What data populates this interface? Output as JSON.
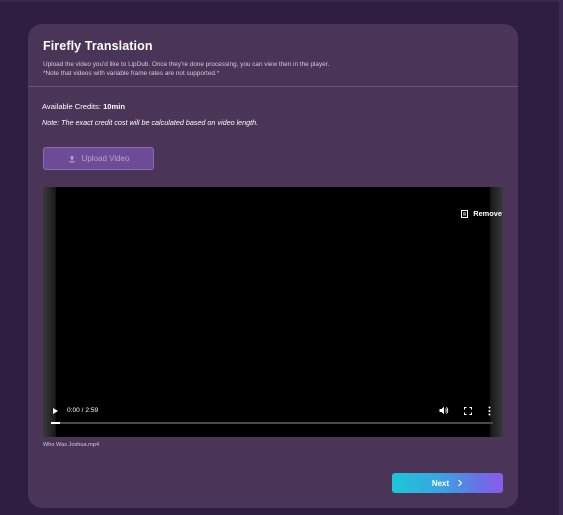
{
  "card": {
    "title": "Firefly Translation",
    "description_line1": "Upload the video you'd like to LipDub. Once they're done processing, you can view then in the player.",
    "description_line2": "*Note that videos with variable frame rates are not supported.*"
  },
  "credits": {
    "label": "Available Credits:",
    "value": "10min"
  },
  "note": "Note: The exact credit cost will be calculated based on video length.",
  "upload": {
    "label": "Upload Video",
    "icon": "upload-icon"
  },
  "video": {
    "remove_label": "Remove",
    "remove_icon": "trash-icon",
    "time_display": "0:00 / 2:59",
    "progress_fraction": 0.02,
    "filename": "Who Was Joshua.mp4"
  },
  "next": {
    "label": "Next",
    "icon": "chevron-right-icon"
  },
  "colors": {
    "background": "#2f1d42",
    "card": "#4a3458",
    "upload_button": "#6e4b96",
    "next_gradient_start": "#1cc7d6",
    "next_gradient_end": "#8a5be6"
  }
}
